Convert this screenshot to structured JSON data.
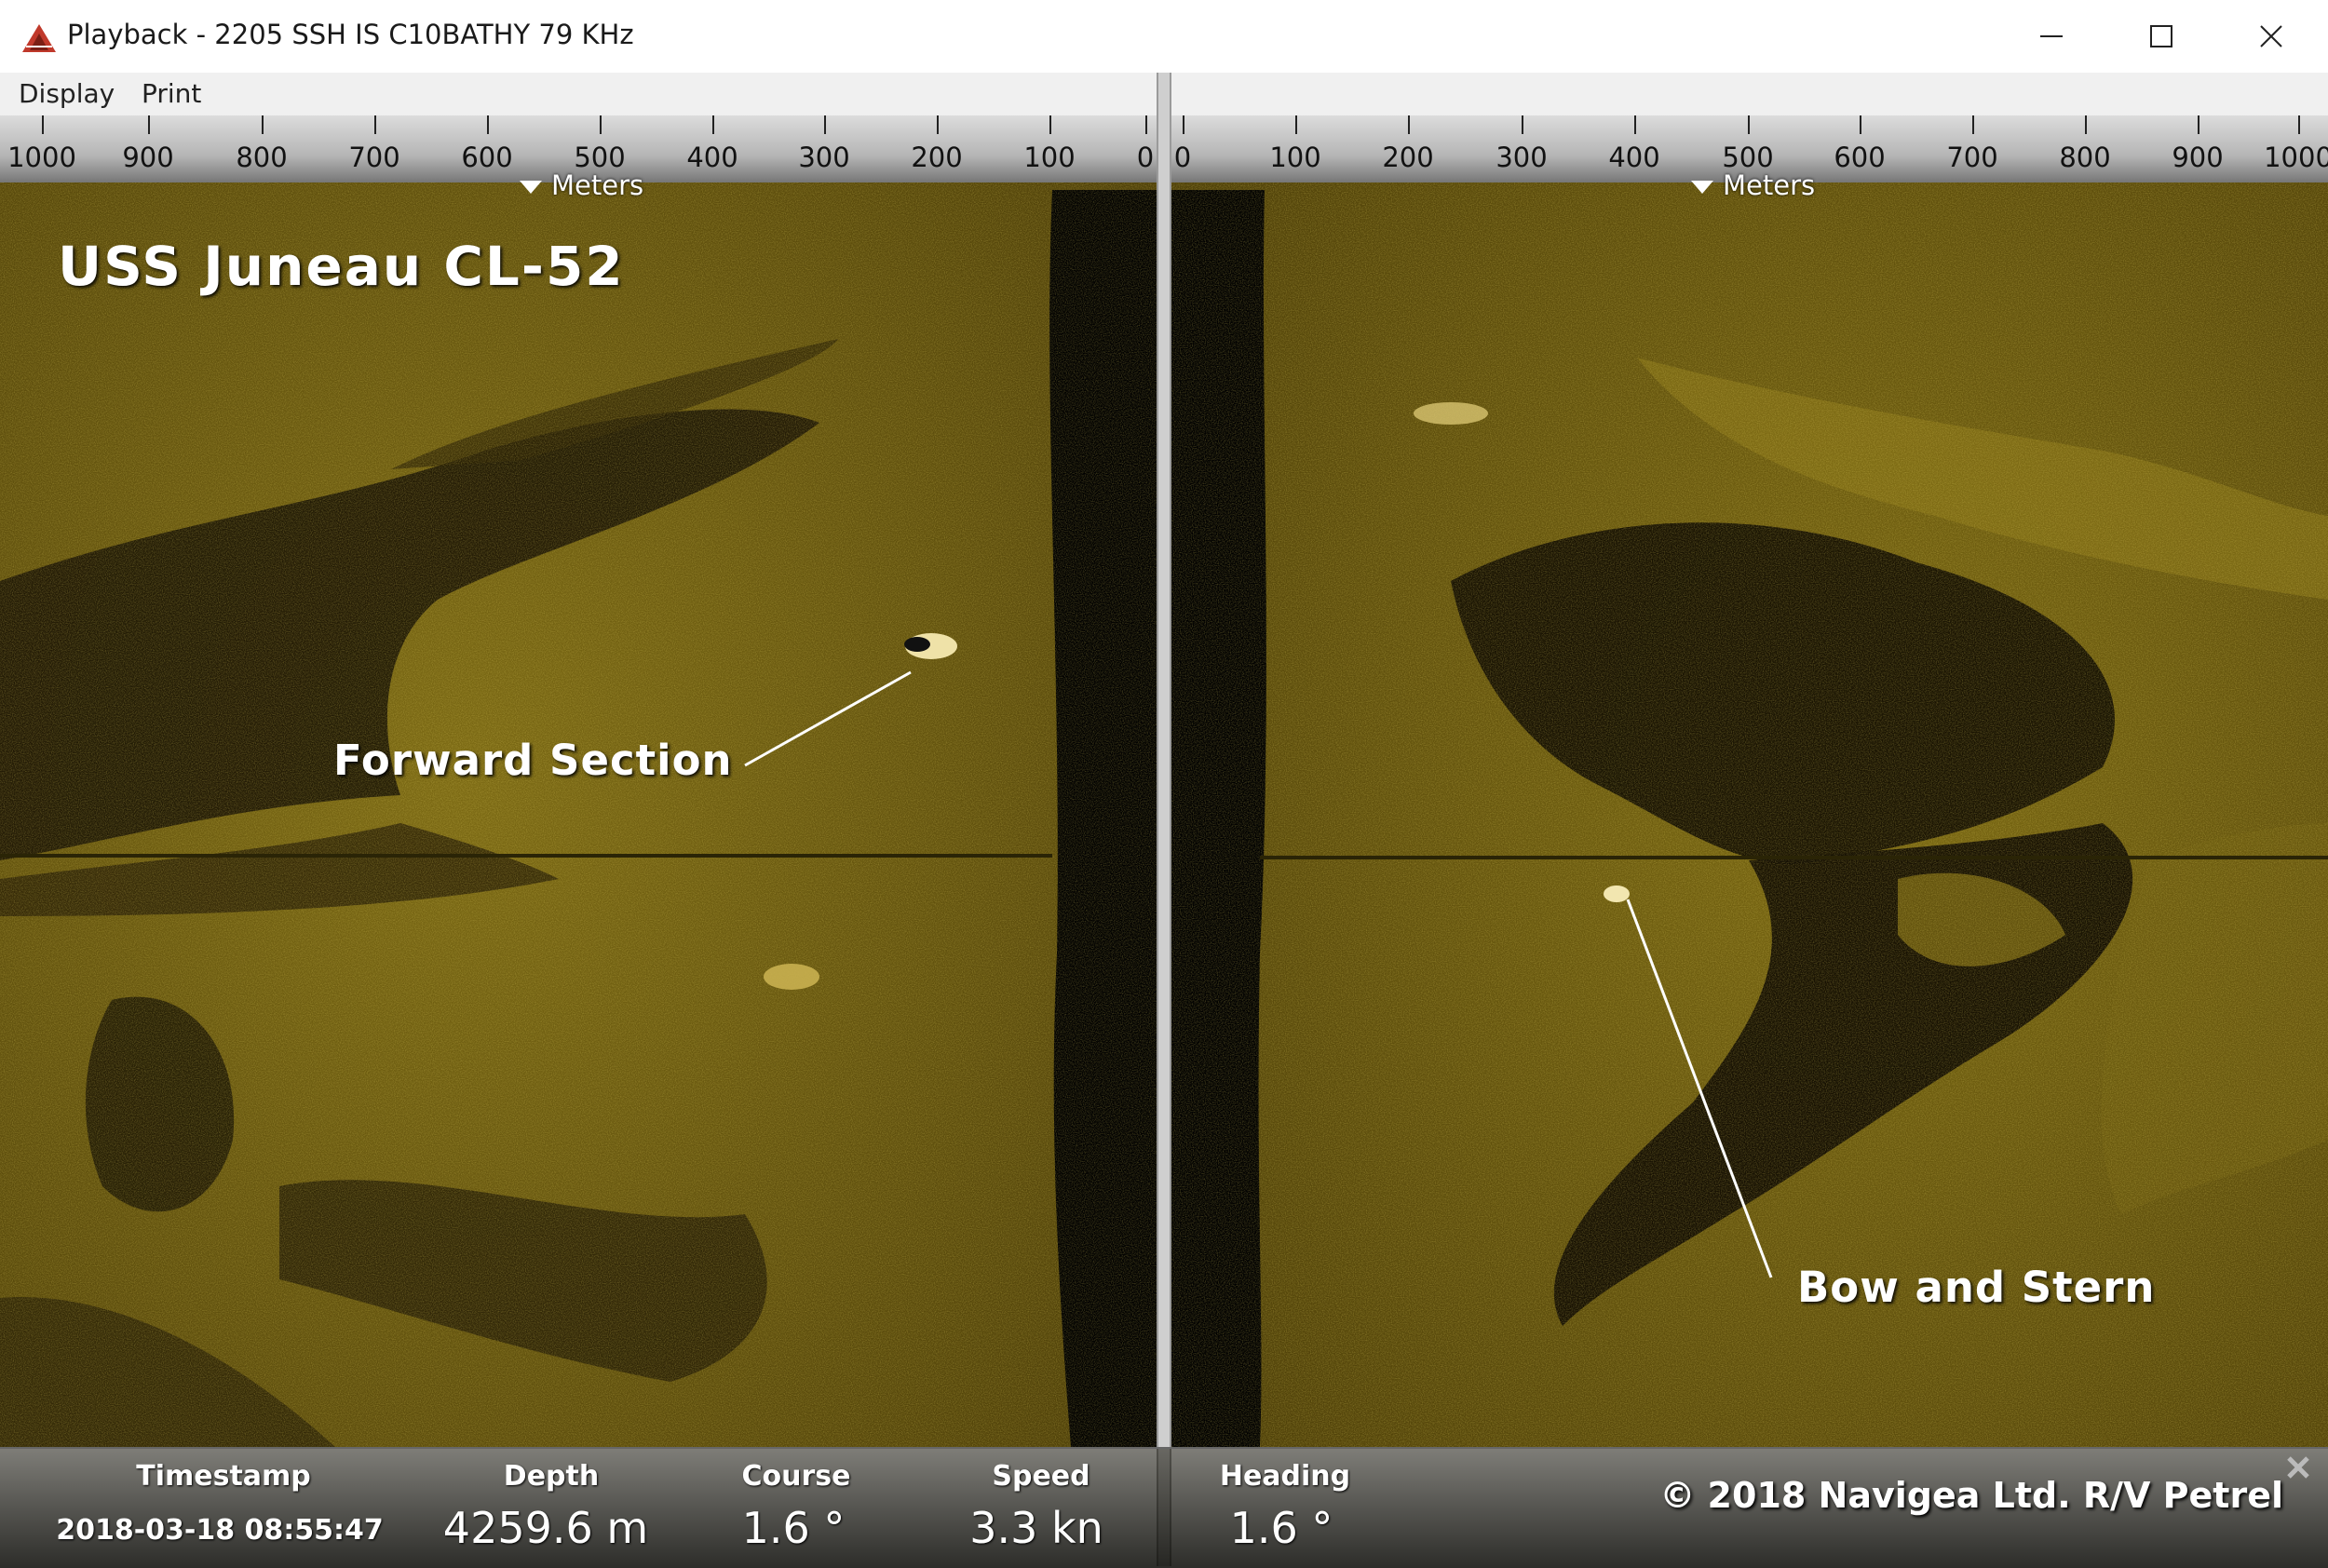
{
  "window": {
    "title": "Playback - 2205 SSH IS C10BATHY 79 KHz",
    "minimize_icon": "minimize-icon",
    "maximize_icon": "maximize-icon",
    "close_icon": "close-icon",
    "accent_color": "#c0392b"
  },
  "menu": {
    "items": [
      {
        "label": "Display"
      },
      {
        "label": "Print"
      }
    ]
  },
  "scale": {
    "left_ticks": [
      "1000",
      "900",
      "800",
      "700",
      "600",
      "500",
      "400",
      "300",
      "200",
      "100",
      "0"
    ],
    "right_ticks": [
      "0",
      "100",
      "200",
      "300",
      "400",
      "500",
      "600",
      "700",
      "800",
      "900",
      "1000"
    ],
    "unit_label": "Meters"
  },
  "annotations": {
    "ship_name": "USS Juneau CL-52",
    "forward_section": "Forward Section",
    "bow_and_stern": "Bow and Stern"
  },
  "status": {
    "fields": [
      {
        "label": "Timestamp",
        "value": "2018-03-18 08:55:47"
      },
      {
        "label": "Depth",
        "value": "4259.6 m"
      },
      {
        "label": "Course",
        "value": "1.6 °"
      },
      {
        "label": "Speed",
        "value": "3.3 kn"
      },
      {
        "label": "Heading",
        "value": "1.6 °"
      }
    ],
    "copyright": "© 2018 Navigea Ltd. R/V Petrel"
  },
  "colors": {
    "sonar_bright": "#8a7415",
    "sonar_mid": "#5a4b0c",
    "sonar_dark": "#1a1403"
  }
}
